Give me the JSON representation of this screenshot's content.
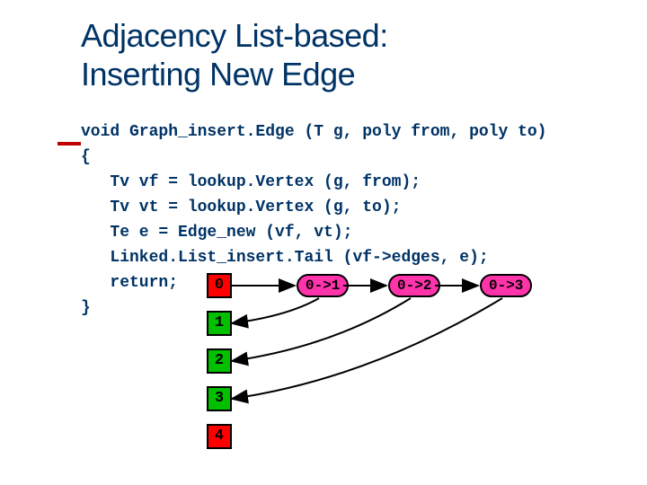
{
  "title": {
    "line1": "Adjacency List-based:",
    "line2": "Inserting New Edge"
  },
  "code": {
    "l0": "void Graph_insert.Edge (T g, poly from, poly to)",
    "l1": "{",
    "l2": "   Tv vf = lookup.Vertex (g, from);",
    "l3": "   Tv vt = lookup.Vertex (g, to);",
    "l4": "   Te e = Edge_new (vf, vt);",
    "l5": "   Linked.List_insert.Tail (vf->edges, e);",
    "l6": "   return;",
    "l7": "}"
  },
  "cells": {
    "c0": "0",
    "c1": "1",
    "c2": "2",
    "c3": "3",
    "c4": "4"
  },
  "pills": {
    "p1": "0->1",
    "p2": "0->2",
    "p3": "0->3"
  }
}
